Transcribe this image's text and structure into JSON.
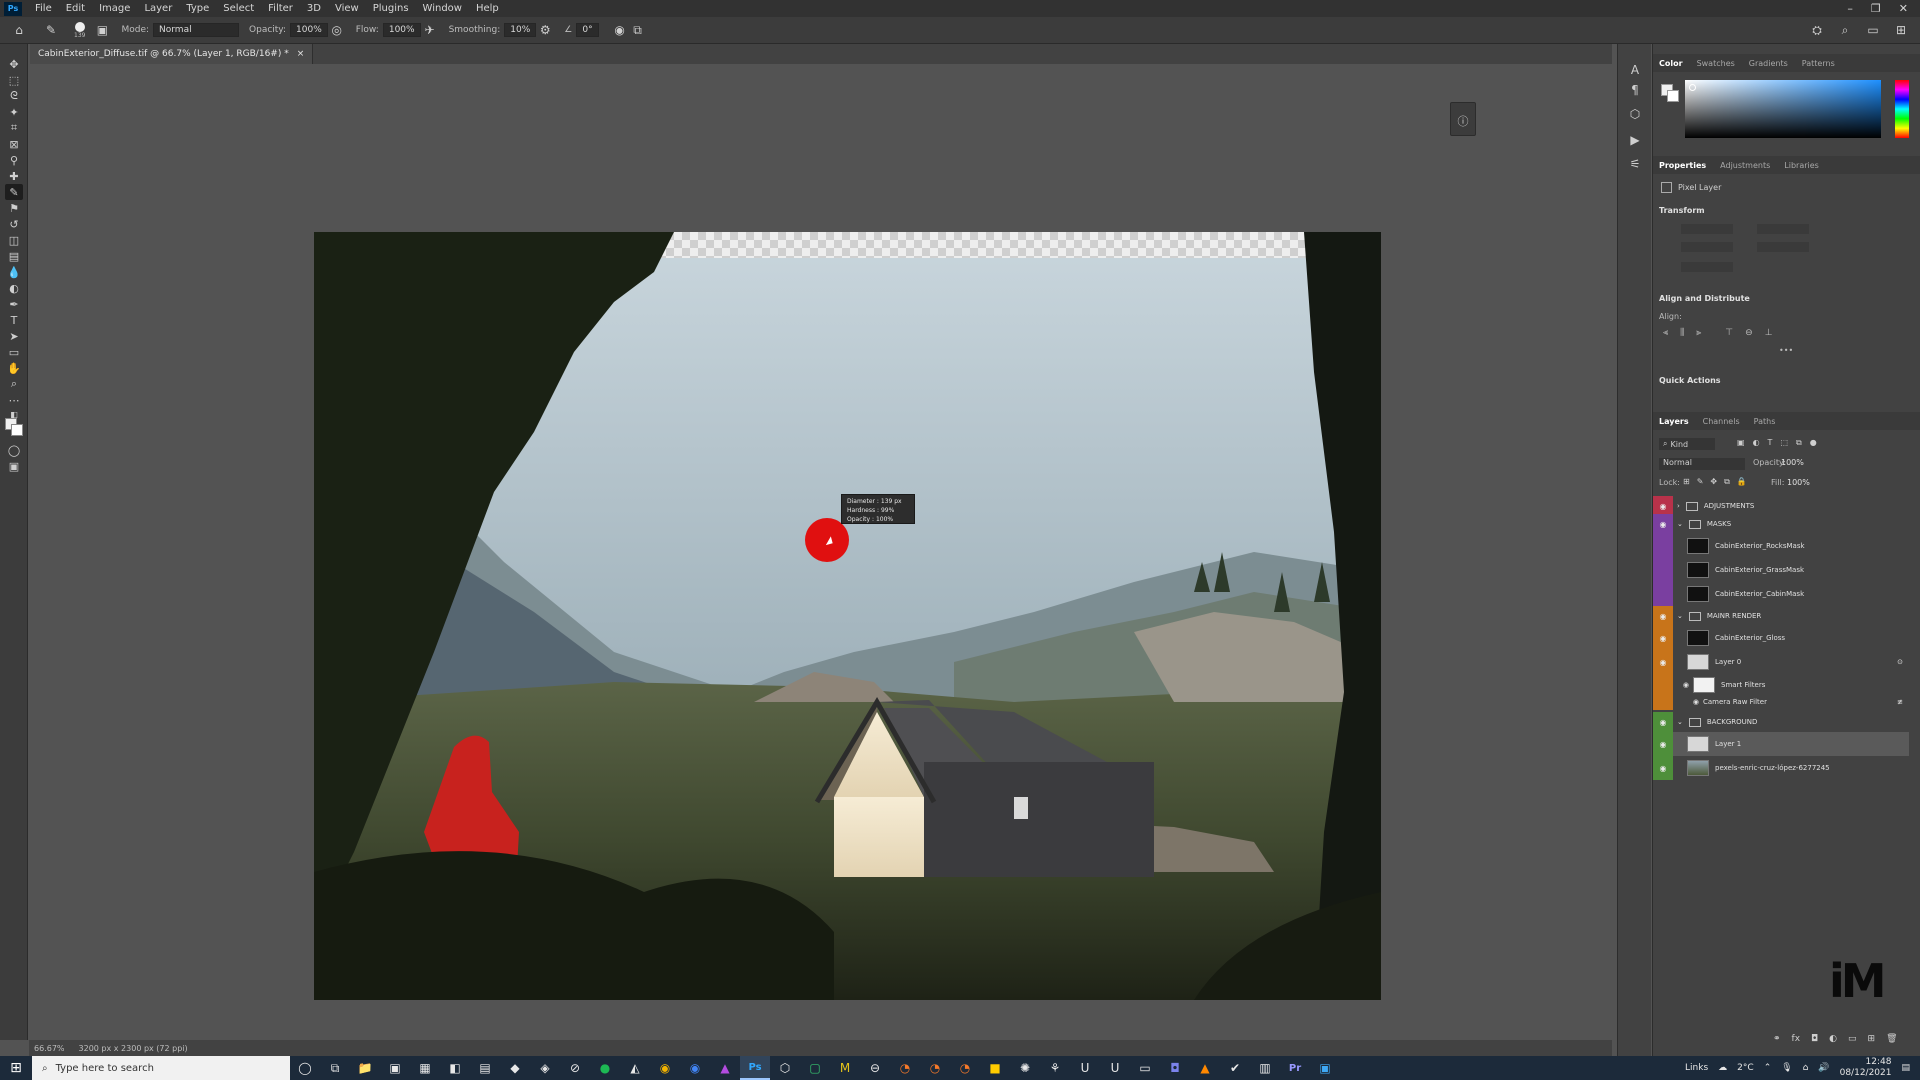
{
  "menubar": {
    "logo": "Ps",
    "items": [
      "File",
      "Edit",
      "Image",
      "Layer",
      "Type",
      "Select",
      "Filter",
      "3D",
      "View",
      "Plugins",
      "Window",
      "Help"
    ],
    "window_controls": [
      "–",
      "❐",
      "✕"
    ]
  },
  "options": {
    "brush_size": "139",
    "mode_label": "Mode:",
    "mode_value": "Normal",
    "opacity_label": "Opacity:",
    "opacity_value": "100%",
    "flow_label": "Flow:",
    "flow_value": "100%",
    "smoothing_label": "Smoothing:",
    "smoothing_value": "10%",
    "angle_value": "0°"
  },
  "document": {
    "tab_title": "CabinExterior_Diffuse.tif @ 66.7% (Layer 1, RGB/16#) *",
    "close": "×"
  },
  "brush_tooltip": {
    "diameter_label": "Diameter :",
    "diameter_value": "139 px",
    "hardness_label": "Hardness :",
    "hardness_value": "99%",
    "opacity_label": "Opacity :",
    "opacity_value": "100%"
  },
  "status": {
    "zoom": "66.67%",
    "doc_size": "3200 px x 2300 px (72 ppi)"
  },
  "color_panel": {
    "tabs": [
      "Color",
      "Swatches",
      "Gradients",
      "Patterns"
    ],
    "active_tab": "Color"
  },
  "properties_panel": {
    "tabs": [
      "Properties",
      "Adjustments",
      "Libraries"
    ],
    "layer_type": "Pixel Layer",
    "transform_title": "Transform",
    "align_title": "Align and Distribute",
    "align_label": "Align:",
    "more": "•••",
    "quick_actions_title": "Quick Actions"
  },
  "layers_panel": {
    "tabs": [
      "Layers",
      "Channels",
      "Paths"
    ],
    "kind_label": "Kind",
    "blend_mode": "Normal",
    "opacity_label": "Opacity:",
    "opacity_value": "100%",
    "lock_label": "Lock:",
    "fill_label": "Fill:",
    "fill_value": "100%",
    "layers": [
      {
        "name": "ADJUSTMENTS",
        "kind": "group",
        "color": "#b8324a"
      },
      {
        "name": "MASKS",
        "kind": "group",
        "color": "#7a3fa0"
      },
      {
        "name": "CabinExterior_RocksMask",
        "kind": "layer",
        "color": "#7a3fa0"
      },
      {
        "name": "CabinExterior_GrassMask",
        "kind": "layer",
        "color": "#7a3fa0"
      },
      {
        "name": "CabinExterior_CabinMask",
        "kind": "layer",
        "color": "#7a3fa0"
      },
      {
        "name": "MAINR RENDER",
        "kind": "group",
        "color": "#c8741a"
      },
      {
        "name": "CabinExterior_Gloss",
        "kind": "layer",
        "color": "#c8741a"
      },
      {
        "name": "Layer 0",
        "kind": "smart",
        "color": "#c8741a"
      },
      {
        "name": "Smart Filters",
        "kind": "filter",
        "color": "#c8741a"
      },
      {
        "name": "Camera Raw Filter",
        "kind": "subfilter",
        "color": "#c8741a"
      },
      {
        "name": "BACKGROUND",
        "kind": "group",
        "color": "#4e8f3a"
      },
      {
        "name": "Layer 1",
        "kind": "selected",
        "color": "#4e8f3a"
      },
      {
        "name": "pexels-enric-cruz-lópez-6277245",
        "kind": "photo",
        "color": "#4e8f3a"
      }
    ]
  },
  "taskbar": {
    "search_placeholder": "Type here to search",
    "links_label": "Links",
    "weather": "2°C",
    "time": "12:48",
    "date": "08/12/2021"
  },
  "watermark": "iM"
}
